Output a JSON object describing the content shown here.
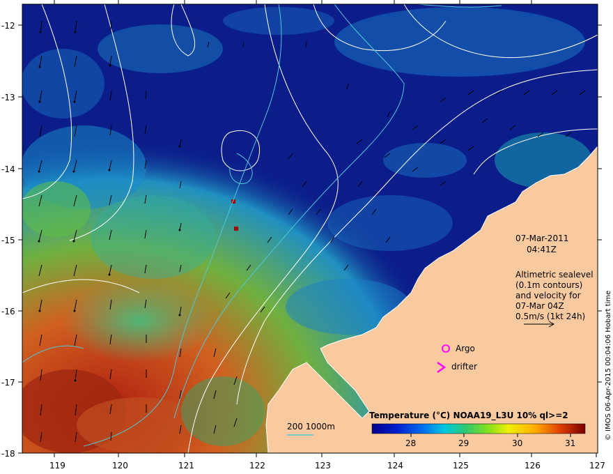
{
  "map": {
    "lon_ticks": [
      "119",
      "120",
      "121",
      "122",
      "123",
      "124",
      "125",
      "126",
      "127"
    ],
    "lat_ticks": [
      "-12",
      "-13",
      "-14",
      "-15",
      "-16",
      "-17",
      "-18"
    ],
    "date": "07-Mar-2011",
    "time": "04:41Z",
    "info_lines": [
      "Altimetric sealevel",
      "(0.1m contours)",
      "and velocity for",
      "07-Mar 04Z",
      "0.5m/s (1kt 24h)"
    ],
    "argo_label": "Argo",
    "drifter_label": "drifter",
    "depth_label": "200  1000m",
    "colorbar_title": "Temperature (°C) NOAA19_L3U 10% ql>=2",
    "colorbar_ticks": [
      "28",
      "29",
      "30",
      "31"
    ],
    "copyright": "© IMOS 06-Apr-2015 00:04:06 Hobart time",
    "colors": {
      "ocean_deep": "#0b1d8a",
      "land": "#f9caa0",
      "contour": "#ffffff",
      "depth_contour": "#4fc8d8",
      "marker": "#ff00ff"
    }
  }
}
